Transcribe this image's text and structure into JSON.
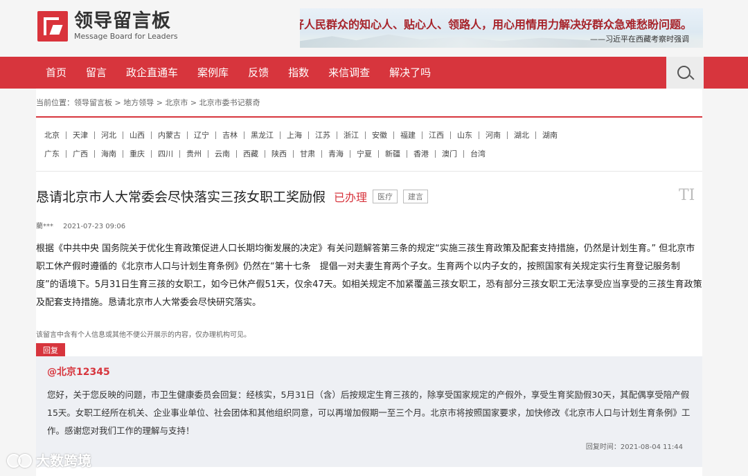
{
  "header": {
    "logo_cn": "领导留言板",
    "logo_en": "Message Board for Leaders",
    "banner_text": "当好人民群众的知心人、贴心人、领路人，用心用情用力解决好群众急难愁盼问题。",
    "banner_sign": "——习近平在西藏考察时强调"
  },
  "nav": {
    "items": [
      "首页",
      "留言",
      "政企直通车",
      "案例库",
      "反馈",
      "指数",
      "来信调查",
      "解决了吗"
    ]
  },
  "breadcrumb": {
    "prefix": "当前位置：",
    "items": [
      "领导留言板",
      "地方领导",
      "北京市",
      "北京市委书记蔡奇"
    ],
    "separator": " > "
  },
  "regions": {
    "row1": [
      "北京",
      "天津",
      "河北",
      "山西",
      "内蒙古",
      "辽宁",
      "吉林",
      "黑龙江",
      "上海",
      "江苏",
      "浙江",
      "安徽",
      "福建",
      "江西",
      "山东",
      "河南",
      "湖北",
      "湖南"
    ],
    "row2": [
      "广东",
      "广西",
      "海南",
      "重庆",
      "四川",
      "贵州",
      "云南",
      "西藏",
      "陕西",
      "甘肃",
      "青海",
      "宁夏",
      "新疆",
      "香港",
      "澳门",
      "台湾"
    ]
  },
  "message": {
    "title": "恳请北京市人大常委会尽快落实三孩女职工奖励假",
    "status": "已办理",
    "tags": [
      "医疗",
      "建言"
    ],
    "font_icon": "TI",
    "author": "藺***",
    "date": "2021-07-23 09:06",
    "body": "根据《中共中央 国务院关于优化生育政策促进人口长期均衡发展的决定》有关问题解答第三条的规定“实施三孩生育政策及配套支持措施，仍然是计划生育。” 但北京市职工休产假时遵循的《北京市人口与计划生育条例》仍然在“第十七条　提倡一对夫妻生育两个子女。生育两个以内子女的，按照国家有关规定实行生育登记服务制度”的语境下。5月31日生育三孩的女职工，如今已休产假51天，仅余47天。如相关规定不加紧覆盖三孩女职工，恐有部分三孩女职工无法享受应当享受的三孩生育政策及配套支持措施。恳请北京市人大常委会尽快研究落实。",
    "privacy_note": "该留言中含有个人信息或其他不便公开展示的内容，仅办理机构可见。"
  },
  "reply": {
    "label": "回复",
    "author": "@北京12345",
    "text": "您好，关于您反映的问题，市卫生健康委员会回复：经核实，5月31日（含）后按规定生育三孩的，除享受国家规定的产假外，享受生育奖励假30天，其配偶享受陪产假15天。女职工经所在机关、企业事业单位、社会团体和其他组织同意，可以再增加假期一至三个月。北京市将按照国家要求，加快修改《北京市人口与计划生育条例》工作。感谢您对我们工作的理解与支持！",
    "time_label": "回复时间：",
    "time": "2021-08-04 11:44"
  },
  "watermark": {
    "text": "大数跨境"
  },
  "colors": {
    "brand_red": "#d7353d",
    "background": "#f5f5f5",
    "reply_bg": "#eef0f4"
  }
}
